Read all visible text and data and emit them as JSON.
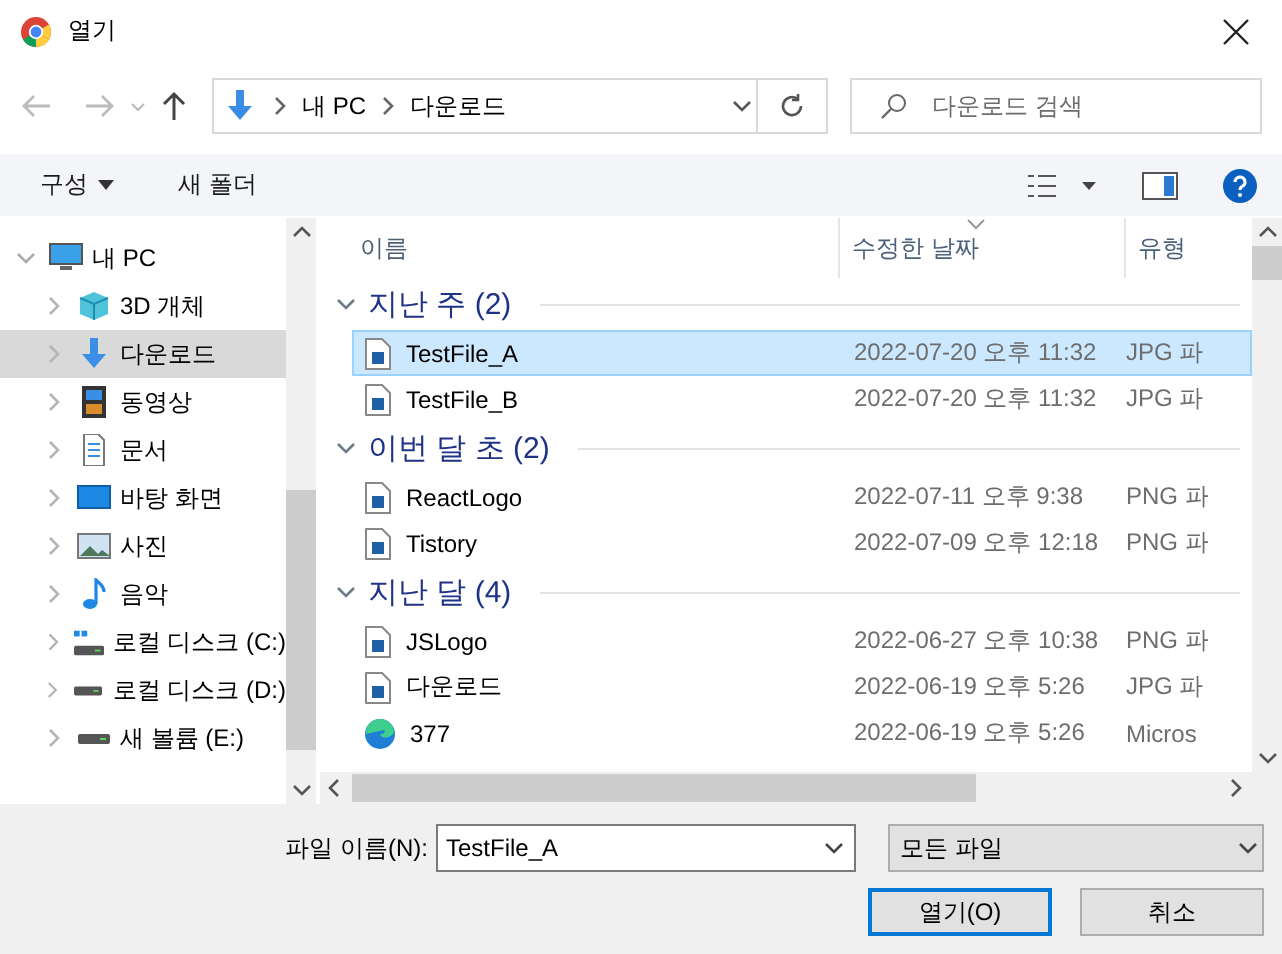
{
  "window": {
    "title": "열기"
  },
  "nav": {
    "breadcrumb": [
      "내 PC",
      "다운로드"
    ],
    "search": {
      "placeholder": "다운로드 검색"
    }
  },
  "toolbar": {
    "organize": "구성",
    "new_folder": "새 폴더"
  },
  "sidebar": {
    "items": [
      {
        "label": "내 PC",
        "kind": "pc",
        "expanded": true,
        "selected": false,
        "children": [
          {
            "label": "3D 개체",
            "kind": "cube",
            "expanded": false,
            "selected": false
          },
          {
            "label": "다운로드",
            "kind": "download",
            "expanded": false,
            "selected": true
          },
          {
            "label": "동영상",
            "kind": "video",
            "expanded": false,
            "selected": false
          },
          {
            "label": "문서",
            "kind": "document",
            "expanded": false,
            "selected": false
          },
          {
            "label": "바탕 화면",
            "kind": "desktop",
            "expanded": false,
            "selected": false
          },
          {
            "label": "사진",
            "kind": "picture",
            "expanded": false,
            "selected": false
          },
          {
            "label": "음악",
            "kind": "music",
            "expanded": false,
            "selected": false
          },
          {
            "label": "로컬 디스크 (C:)",
            "kind": "system-drive",
            "expanded": false,
            "selected": false
          },
          {
            "label": "로컬 디스크 (D:)",
            "kind": "drive",
            "expanded": false,
            "selected": false
          },
          {
            "label": "새 볼륨 (E:)",
            "kind": "drive",
            "expanded": false,
            "selected": false
          }
        ]
      }
    ]
  },
  "file_list": {
    "columns": [
      "이름",
      "수정한 날짜",
      "유형"
    ],
    "groups": [
      {
        "title": "지난 주 (2)",
        "expanded": true,
        "files": [
          {
            "name": "TestFile_A",
            "date": "2022-07-20 오후 11:32",
            "type": "JPG 파",
            "kind": "image",
            "selected": true
          },
          {
            "name": "TestFile_B",
            "date": "2022-07-20 오후 11:32",
            "type": "JPG 파",
            "kind": "image",
            "selected": false
          }
        ]
      },
      {
        "title": "이번 달 초 (2)",
        "expanded": true,
        "files": [
          {
            "name": "ReactLogo",
            "date": "2022-07-11 오후 9:38",
            "type": "PNG 파",
            "kind": "image",
            "selected": false
          },
          {
            "name": "Tistory",
            "date": "2022-07-09 오후 12:18",
            "type": "PNG 파",
            "kind": "image",
            "selected": false
          }
        ]
      },
      {
        "title": "지난 달 (4)",
        "expanded": true,
        "files": [
          {
            "name": "JSLogo",
            "date": "2022-06-27 오후 10:38",
            "type": "PNG 파",
            "kind": "image",
            "selected": false
          },
          {
            "name": "다운로드",
            "date": "2022-06-19 오후 5:26",
            "type": "JPG 파",
            "kind": "image",
            "selected": false
          },
          {
            "name": "377",
            "date": "2022-06-19 오후 5:26",
            "type": "Micros",
            "kind": "browser",
            "selected": false
          }
        ]
      }
    ]
  },
  "footer": {
    "filename_label": "파일 이름(N):",
    "filename": "TestFile_A",
    "filter": "모든 파일",
    "buttons": [
      {
        "label": "열기(O)",
        "default": true
      },
      {
        "label": "취소",
        "default": false
      }
    ]
  }
}
